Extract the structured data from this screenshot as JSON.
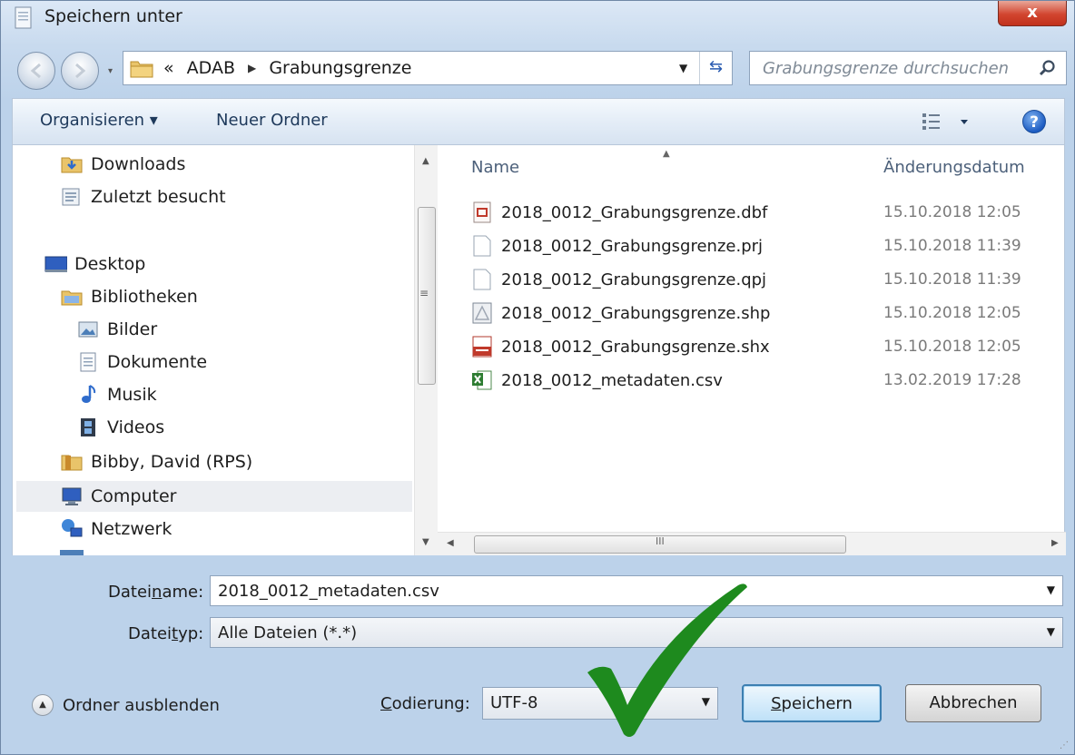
{
  "window": {
    "title": "Speichern unter",
    "close_label": "x"
  },
  "address": {
    "overflow": "«",
    "crumbs": [
      "ADAB",
      "Grabungsgrenze"
    ],
    "search_placeholder": "Grabungsgrenze durchsuchen"
  },
  "toolbar": {
    "organize_label": "Organisieren ▾",
    "new_folder_label": "Neuer Ordner",
    "help_label": "?"
  },
  "sidebar": {
    "items": [
      {
        "label": "Downloads",
        "icon": "downloads-folder-icon"
      },
      {
        "label": "Zuletzt besucht",
        "icon": "recent-places-icon"
      },
      {
        "label": "Desktop",
        "icon": "desktop-icon"
      },
      {
        "label": "Bibliotheken",
        "icon": "libraries-icon"
      },
      {
        "label": "Bilder",
        "icon": "pictures-icon"
      },
      {
        "label": "Dokumente",
        "icon": "documents-icon"
      },
      {
        "label": "Musik",
        "icon": "music-icon"
      },
      {
        "label": "Videos",
        "icon": "videos-icon"
      },
      {
        "label": "Bibby, David (RPS)",
        "icon": "user-folder-icon"
      },
      {
        "label": "Computer",
        "icon": "computer-icon",
        "selected": true
      },
      {
        "label": "Netzwerk",
        "icon": "network-icon"
      }
    ]
  },
  "files": {
    "columns": {
      "name": "Name",
      "date": "Änderungsdatum"
    },
    "rows": [
      {
        "name": "2018_0012_Grabungsgrenze.dbf",
        "date": "15.10.2018 12:05",
        "icon": "dbf-file-icon"
      },
      {
        "name": "2018_0012_Grabungsgrenze.prj",
        "date": "15.10.2018 11:39",
        "icon": "blank-file-icon"
      },
      {
        "name": "2018_0012_Grabungsgrenze.qpj",
        "date": "15.10.2018 11:39",
        "icon": "blank-file-icon"
      },
      {
        "name": "2018_0012_Grabungsgrenze.shp",
        "date": "15.10.2018 12:05",
        "icon": "shp-file-icon"
      },
      {
        "name": "2018_0012_Grabungsgrenze.shx",
        "date": "15.10.2018 12:05",
        "icon": "shx-file-icon"
      },
      {
        "name": "2018_0012_metadaten.csv",
        "date": "13.02.2019 17:28",
        "icon": "excel-csv-file-icon"
      }
    ]
  },
  "form": {
    "filename_label_pre": "Datei",
    "filename_label_u": "n",
    "filename_label_post": "ame:",
    "filename_value": "2018_0012_metadaten.csv",
    "filetype_label_pre": "Datei",
    "filetype_label_u": "t",
    "filetype_label_post": "yp:",
    "filetype_value": "Alle Dateien  (*.*)",
    "hide_folders_label": "Ordner ausblenden",
    "encoding_label_u": "C",
    "encoding_label_post": "odierung:",
    "encoding_value": "UTF-8",
    "save_label_u": "S",
    "save_label_post": "peichern",
    "cancel_label": "Abbrechen"
  },
  "scrollbar_glyphs": {
    "grip_v": "≡",
    "grip_h": "III"
  },
  "colors": {
    "checkmark": "#1e8a1e",
    "selection": "#eceef2",
    "close": "#d2452f"
  }
}
